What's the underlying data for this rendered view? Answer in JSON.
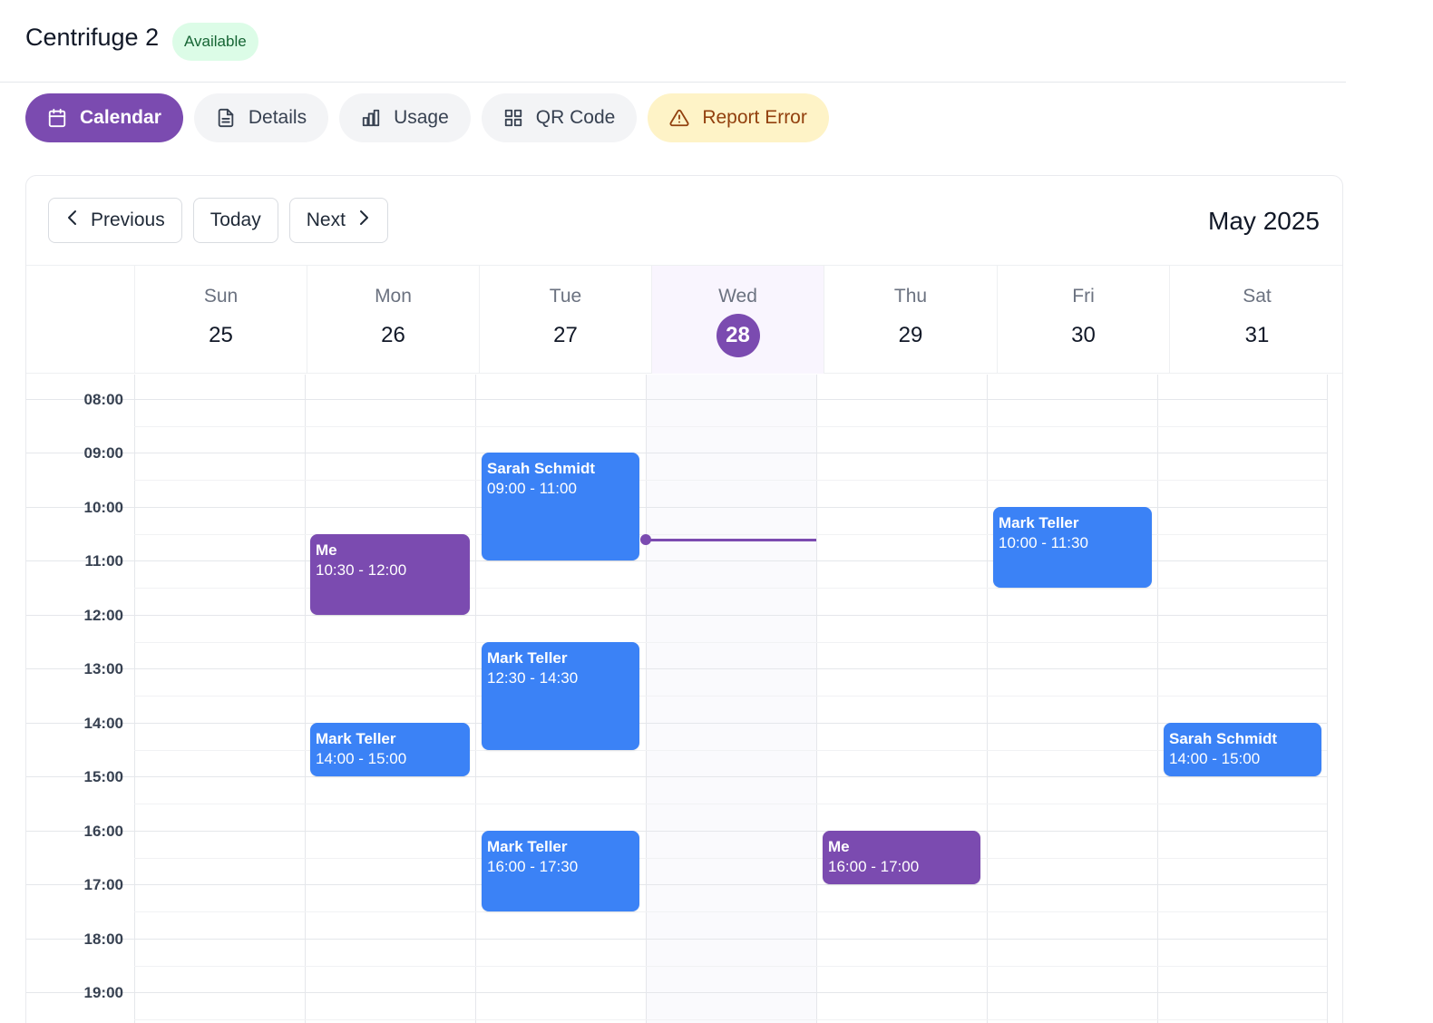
{
  "header": {
    "title": "Centrifuge 2",
    "status": "Available"
  },
  "tabs": [
    {
      "label": "Calendar",
      "icon": "calendar-icon"
    },
    {
      "label": "Details",
      "icon": "document-icon"
    },
    {
      "label": "Usage",
      "icon": "bar-chart-icon"
    },
    {
      "label": "QR Code",
      "icon": "qr-code-icon"
    },
    {
      "label": "Report Error",
      "icon": "warning-icon"
    }
  ],
  "calendar": {
    "prev_label": "Previous",
    "today_label": "Today",
    "next_label": "Next",
    "month": "May 2025",
    "days": [
      {
        "name": "Sun",
        "num": "25"
      },
      {
        "name": "Mon",
        "num": "26"
      },
      {
        "name": "Tue",
        "num": "27"
      },
      {
        "name": "Wed",
        "num": "28"
      },
      {
        "name": "Thu",
        "num": "29"
      },
      {
        "name": "Fri",
        "num": "30"
      },
      {
        "name": "Sat",
        "num": "31"
      }
    ],
    "times": [
      "08:00",
      "09:00",
      "10:00",
      "11:00",
      "12:00",
      "13:00",
      "14:00",
      "15:00",
      "16:00",
      "17:00",
      "18:00",
      "19:00"
    ],
    "events": [
      {
        "name": "Sarah Schmidt",
        "time": "09:00 - 11:00",
        "color": "#3b82f6"
      },
      {
        "name": "Me",
        "time": "10:30 - 12:00",
        "color": "#7b4bb0"
      },
      {
        "name": "Mark Teller",
        "time": "10:00 - 11:30",
        "color": "#3b82f6"
      },
      {
        "name": "Mark Teller",
        "time": "12:30 - 14:30",
        "color": "#3b82f6"
      },
      {
        "name": "Mark Teller",
        "time": "14:00 - 15:00",
        "color": "#3b82f6"
      },
      {
        "name": "Sarah Schmidt",
        "time": "14:00 - 15:00",
        "color": "#3b82f6"
      },
      {
        "name": "Mark Teller",
        "time": "16:00 - 17:30",
        "color": "#3b82f6"
      },
      {
        "name": "Me",
        "time": "16:00 - 17:00",
        "color": "#7b4bb0"
      }
    ]
  },
  "colors": {
    "accent": "#7b4bb0",
    "event_blue": "#3b82f6",
    "available_bg": "#dcfce7",
    "warning_bg": "#fef3c7"
  }
}
